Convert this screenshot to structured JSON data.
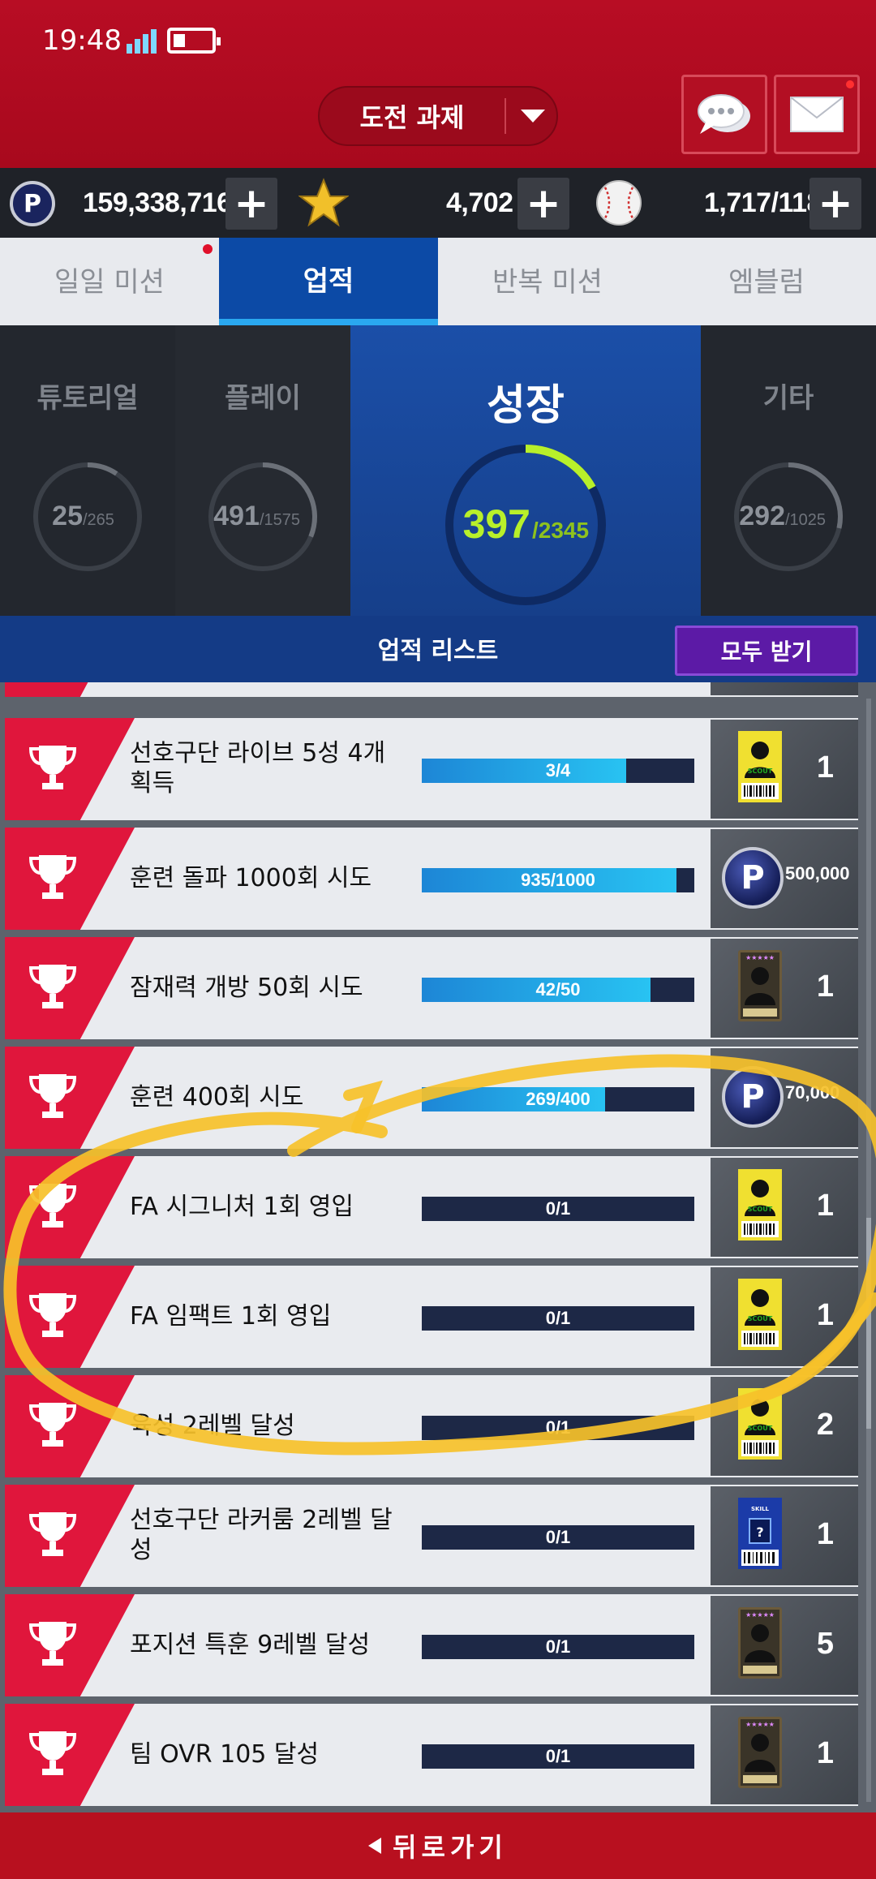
{
  "status_bar": {
    "time": "19:48"
  },
  "header": {
    "challenge_label": "도전 과제",
    "chat_icon": "chat-bubble-icon",
    "mail_icon": "envelope-icon"
  },
  "currency": {
    "points": "159,338,716",
    "stars": "4,702",
    "balls": "1,717/118",
    "plus": "+"
  },
  "tabs": [
    {
      "label": "일일 미션",
      "active": false
    },
    {
      "label": "업적",
      "active": true
    },
    {
      "label": "반복 미션",
      "active": false
    },
    {
      "label": "엠블럼",
      "active": false
    }
  ],
  "categories": [
    {
      "label": "튜토리얼",
      "value": "25",
      "total": "/265",
      "progress": 0.094
    },
    {
      "label": "플레이",
      "value": "491",
      "total": "/1575",
      "progress": 0.312
    },
    {
      "label": "성장",
      "value": "397",
      "total": "/2345",
      "progress": 0.169
    },
    {
      "label": "기타",
      "value": "292",
      "total": "/1025",
      "progress": 0.285
    }
  ],
  "list_header": {
    "title": "업적 리스트",
    "receive_all": "모두 받기"
  },
  "achievements": [
    {
      "title": "선호구단 라이브 5성 4개 획득",
      "progress_text": "3/4",
      "progress": 0.75,
      "reward_type": "scout-ticket",
      "reward_qty": "1"
    },
    {
      "title": "훈련 돌파 1000회 시도",
      "progress_text": "935/1000",
      "progress": 0.935,
      "reward_type": "points",
      "reward_qty": "500,000"
    },
    {
      "title": "잠재력 개방 50회 시도",
      "progress_text": "42/50",
      "progress": 0.84,
      "reward_type": "enhance-card",
      "reward_qty": "1"
    },
    {
      "title": "훈련 400회 시도",
      "progress_text": "269/400",
      "progress": 0.6725,
      "reward_type": "points",
      "reward_qty": "70,000"
    },
    {
      "title": "FA 시그니처 1회 영입",
      "progress_text": "0/1",
      "progress": 0,
      "reward_type": "scout-ticket",
      "reward_qty": "1"
    },
    {
      "title": "FA 임팩트 1회 영입",
      "progress_text": "0/1",
      "progress": 0,
      "reward_type": "scout-ticket",
      "reward_qty": "1"
    },
    {
      "title": "육성 2레벨 달성",
      "progress_text": "0/1",
      "progress": 0,
      "reward_type": "scout-ticket",
      "reward_qty": "2"
    },
    {
      "title": "선호구단 라커룸 2레벨 달성",
      "progress_text": "0/1",
      "progress": 0,
      "reward_type": "skill-change",
      "reward_qty": "1"
    },
    {
      "title": "포지션 특훈 9레벨 달성",
      "progress_text": "0/1",
      "progress": 0,
      "reward_type": "enhance-card",
      "reward_qty": "5"
    },
    {
      "title": "팀 OVR 105 달성",
      "progress_text": "0/1",
      "progress": 0,
      "reward_type": "enhance-card",
      "reward_qty": "1"
    }
  ],
  "back": {
    "label": "뒤로가기"
  },
  "colors": {
    "header_red": "#b80d24",
    "tab_active": "#0c4aa6",
    "accent_green": "#b8f02a",
    "row_red": "#e0163c",
    "highlight_yellow": "#f6c12a"
  }
}
